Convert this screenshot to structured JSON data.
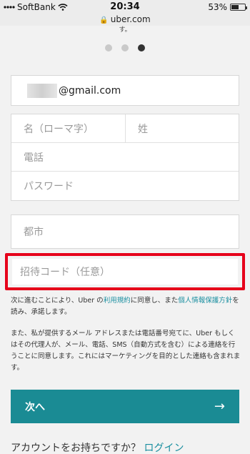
{
  "status": {
    "carrier": "SoftBank",
    "time": "20:34",
    "battery": "53%",
    "battery_level": 0.53
  },
  "browser": {
    "url": "uber.com"
  },
  "top_snippet": "す。",
  "pager": {
    "pages": 3,
    "active": 3
  },
  "form": {
    "email_suffix": "@gmail.com",
    "first_name_placeholder": "名（ローマ字）",
    "last_name_placeholder": "姓",
    "phone_placeholder": "電話",
    "password_placeholder": "パスワード",
    "city_placeholder": "都市",
    "invite_placeholder": "招待コード（任意）"
  },
  "terms": {
    "part1": "次に進むことにより、Uber の",
    "terms_link": "利用規約",
    "part2": "に同意し、また",
    "privacy_link": "個人情報保護方針",
    "part3": "を読み、承諾します。",
    "marketing": "また、私が提供するメール アドレスまたは電話番号宛てに、Uber もしくはその代理人が、メール、電話、SMS（自動方式を含む）による連絡を行うことに同意します。これにはマーケティングを目的とした連絡も含まれます。"
  },
  "next_button": {
    "label": "次へ",
    "arrow": "→"
  },
  "footer": {
    "question": "アカウントをお持ちですか？",
    "login_link": "ログイン"
  }
}
